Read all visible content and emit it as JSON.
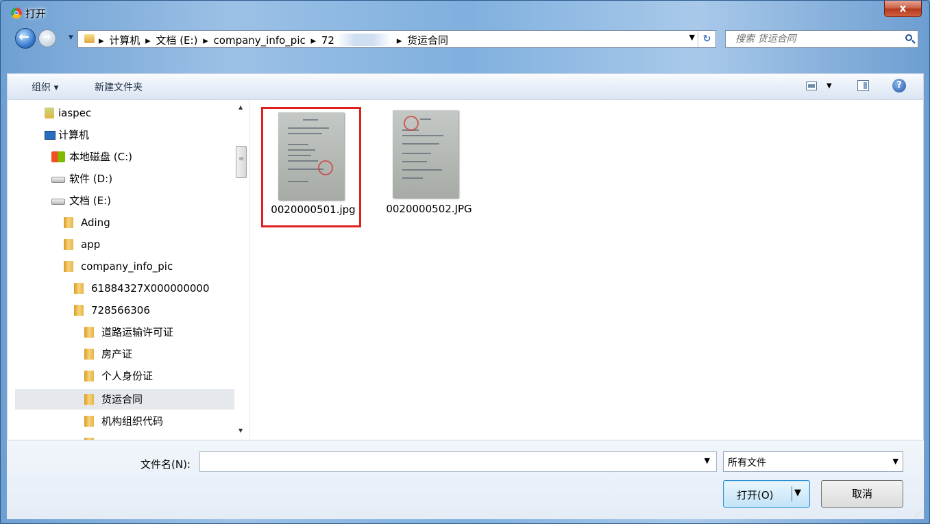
{
  "window": {
    "title": "打开",
    "close_label": "x"
  },
  "address": {
    "crumbs": [
      "计算机",
      "文档 (E:)",
      "company_info_pic",
      "72",
      "货运合同"
    ]
  },
  "search": {
    "placeholder": "搜索 货运合同"
  },
  "toolbar": {
    "organize_label": "组织 ▾",
    "new_folder_label": "新建文件夹"
  },
  "nav_tree": [
    {
      "label": "iaspec",
      "icon": "user-folder-icon",
      "level": 1
    },
    {
      "label": "计算机",
      "icon": "computer-icon",
      "level": 1
    },
    {
      "label": "本地磁盘 (C:)",
      "icon": "local-disk-icon",
      "level": 2
    },
    {
      "label": "软件 (D:)",
      "icon": "drive-icon",
      "level": 2
    },
    {
      "label": "文档 (E:)",
      "icon": "drive-icon",
      "level": 2
    },
    {
      "label": "Ading",
      "icon": "folder-icon",
      "level": 3
    },
    {
      "label": "app",
      "icon": "folder-icon",
      "level": 3
    },
    {
      "label": "company_info_pic",
      "icon": "folder-icon",
      "level": 3
    },
    {
      "label": "61884327X000000000",
      "icon": "folder-icon",
      "level": 4
    },
    {
      "label": "728566306",
      "icon": "folder-icon",
      "level": 4
    },
    {
      "label": "道路运输许可证",
      "icon": "folder-icon",
      "level": 5
    },
    {
      "label": "房产证",
      "icon": "folder-icon",
      "level": 5
    },
    {
      "label": "个人身份证",
      "icon": "folder-icon",
      "level": 5
    },
    {
      "label": "货运合同",
      "icon": "folder-icon",
      "level": 5,
      "selected": true
    },
    {
      "label": "机构组织代码",
      "icon": "folder-icon",
      "level": 5
    }
  ],
  "files": [
    {
      "name": "0020000501.jpg",
      "selected": true
    },
    {
      "name": "0020000502.JPG",
      "selected": false
    }
  ],
  "bottom": {
    "filename_label": "文件名(N):",
    "filename_value": "",
    "filetype_value": "所有文件",
    "open_label": "打开(O)",
    "cancel_label": "取消"
  }
}
